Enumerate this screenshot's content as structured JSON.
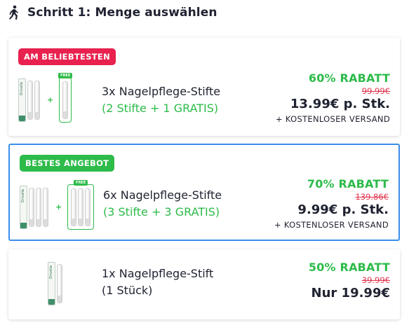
{
  "step": {
    "title": "Schritt 1: Menge auswählen",
    "icon": "walking-person-icon"
  },
  "colors": {
    "accent_green": "#2dbb4a",
    "badge_red": "#e8214e",
    "price_red": "#e0334b",
    "selected_border": "#3b8ded"
  },
  "offers": [
    {
      "badge": "AM BELIEBTESTEN",
      "badge_color": "#e8214e",
      "title": "3x Nagelpflege-Stifte",
      "subtitle": "(2 Stifte + 1 GRATIS)",
      "discount": "60% RABATT",
      "old_price": "99.99€",
      "price": "13.99€ p. Stk.",
      "shipping": "+ KOSTENLOSER VERSAND",
      "free_label": "FREE",
      "box_label": "Orivella",
      "selected": false
    },
    {
      "badge": "BESTES ANGEBOT",
      "badge_color": "#2dbb4a",
      "title": "6x Nagelpflege-Stifte",
      "subtitle": "(3 Stifte + 3 GRATIS)",
      "discount": "70% RABATT",
      "old_price": "139.86€",
      "price": "9.99€ p. Stk.",
      "shipping": "+ KOSTENLOSER VERSAND",
      "free_label": "FREE",
      "box_label": "Orivella",
      "selected": true
    },
    {
      "badge": "",
      "title": "1x Nagelpflege-Stift",
      "subtitle": "(1 Stück)",
      "discount": "50% RABATT",
      "old_price": "39.99€",
      "price": "Nur 19.99€",
      "box_label": "Orivella",
      "selected": false
    }
  ]
}
